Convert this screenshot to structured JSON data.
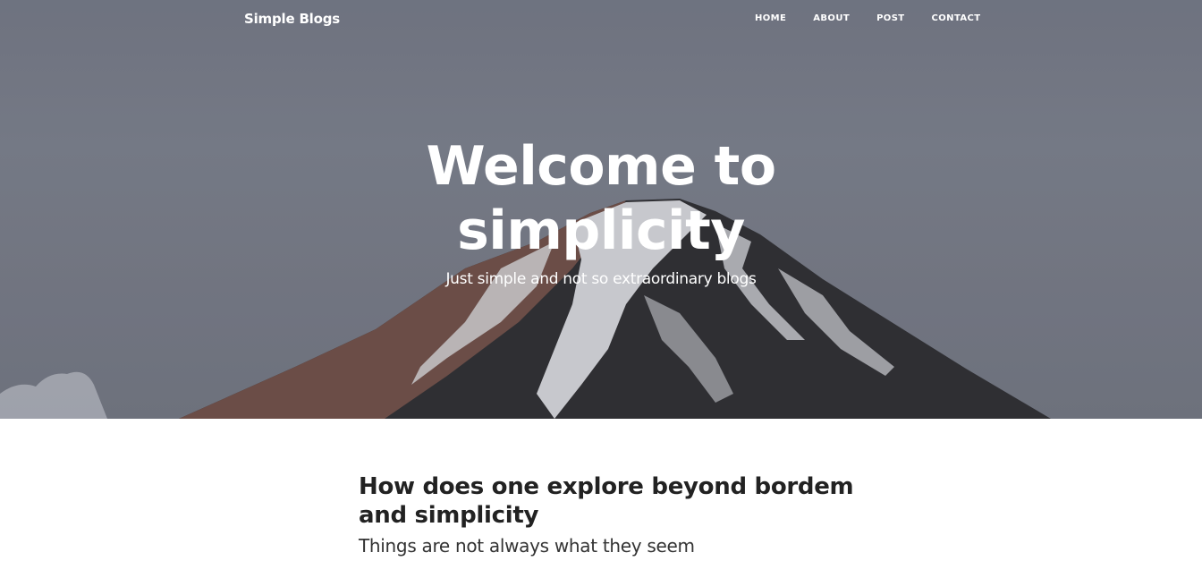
{
  "nav": {
    "brand": "Simple Blogs",
    "links": [
      {
        "label": "HOME"
      },
      {
        "label": "ABOUT"
      },
      {
        "label": "POST"
      },
      {
        "label": "CONTACT"
      }
    ]
  },
  "hero": {
    "title_line1": "Welcome to",
    "title_line2": "simplicity",
    "subtitle": "Just simple and not so extraordinary blogs",
    "image": "snow-capped-mountain-photo"
  },
  "post": {
    "title": "How does one explore beyond bordem and simplicity",
    "subtitle": "Things are not always what they seem"
  },
  "colors": {
    "sky": "#717683",
    "mountain_dark": "#1e1e20",
    "snow": "#d9dadd",
    "text_dark": "#222222"
  }
}
